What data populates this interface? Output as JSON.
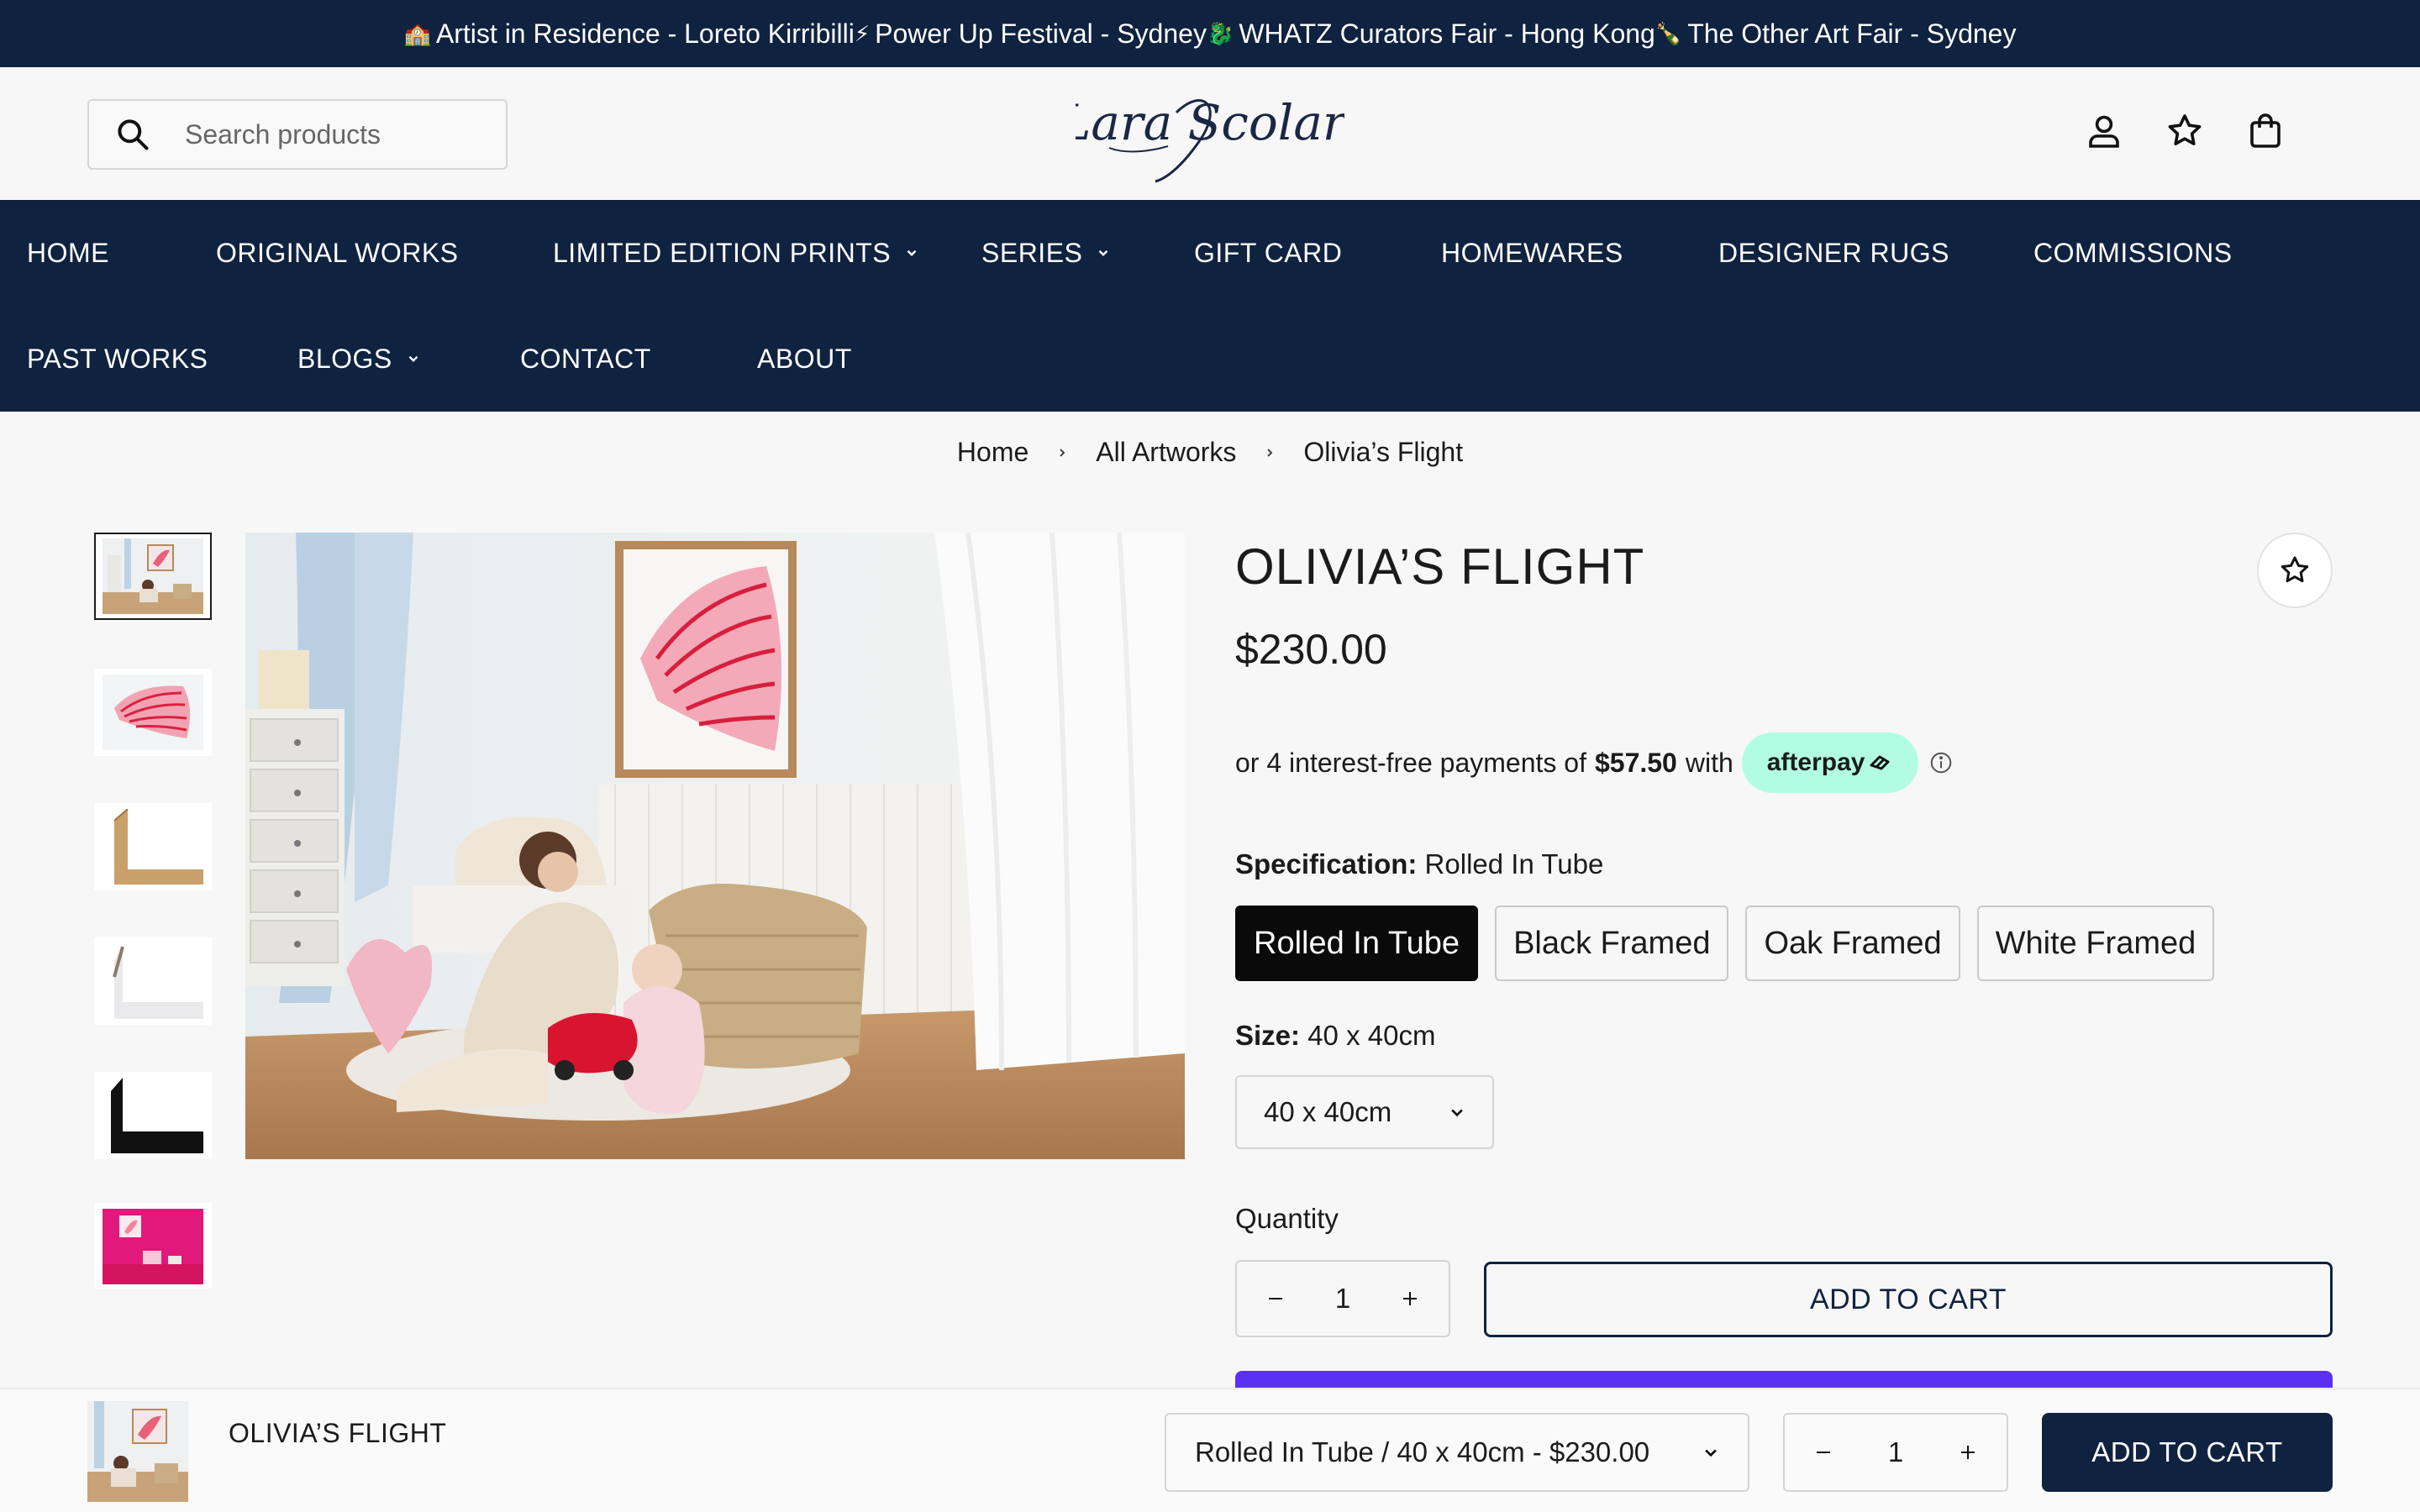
{
  "announcement": {
    "items": [
      {
        "emoji": "🏫",
        "text": "Artist in Residence - Loreto Kirribilli"
      },
      {
        "emoji": "⚡",
        "text": "Power Up Festival - Sydney"
      },
      {
        "emoji": "🐉",
        "text": "WHATZ Curators Fair - Hong Kong"
      },
      {
        "emoji": "🍾",
        "text": "The Other Art Fair - Sydney"
      }
    ]
  },
  "header": {
    "search_placeholder": "Search products",
    "logo_text": "Lara Scolari"
  },
  "nav": {
    "row1": [
      {
        "label": "HOME",
        "dropdown": false
      },
      {
        "label": "ORIGINAL WORKS",
        "dropdown": false
      },
      {
        "label": "LIMITED EDITION PRINTS",
        "dropdown": true
      },
      {
        "label": "SERIES",
        "dropdown": true
      },
      {
        "label": "GIFT CARD",
        "dropdown": false
      },
      {
        "label": "HOMEWARES",
        "dropdown": false
      },
      {
        "label": "DESIGNER RUGS",
        "dropdown": false
      },
      {
        "label": "COMMISSIONS",
        "dropdown": false
      }
    ],
    "row2": [
      {
        "label": "PAST WORKS",
        "dropdown": false
      },
      {
        "label": "BLOGS",
        "dropdown": true
      },
      {
        "label": "CONTACT",
        "dropdown": false
      },
      {
        "label": "ABOUT",
        "dropdown": false
      }
    ]
  },
  "breadcrumb": [
    "Home",
    "All Artworks",
    "Olivia’s Flight"
  ],
  "product": {
    "title": "OLIVIA’S FLIGHT",
    "price": "$230.00",
    "afterpay": {
      "prefix": "or 4 interest-free payments of",
      "amount": "$57.50",
      "suffix": "with",
      "brand": "afterpay"
    },
    "spec_label": "Specification:",
    "spec_value": "Rolled In Tube",
    "spec_options": [
      "Rolled In Tube",
      "Black Framed",
      "Oak Framed",
      "White Framed"
    ],
    "selected_spec": "Rolled In Tube",
    "size_label": "Size:",
    "size_value": "40 x 40cm",
    "size_selected": "40 x 40cm",
    "quantity_label": "Quantity",
    "quantity": "1",
    "add_to_cart": "ADD TO CART"
  },
  "sticky_bar": {
    "title": "OLIVIA’S FLIGHT",
    "variant": "Rolled In Tube / 40 x 40cm - $230.00",
    "quantity": "1",
    "add_to_cart": "ADD TO CART"
  },
  "colors": {
    "navy": "#0f2240",
    "afterpay_mint": "#b2fce4",
    "shop_pay_purple": "#5a31f4"
  }
}
